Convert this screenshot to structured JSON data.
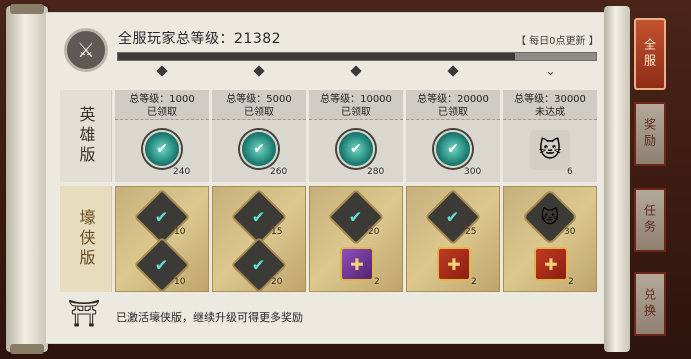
{
  "header": {
    "title_prefix": "全服玩家总等级：",
    "server_level": "21382",
    "refresh_note": "【 每日0点更新 】",
    "progress_fraction": 0.83
  },
  "rows": {
    "hero_label": "英雄版",
    "luxe_label": "壕侠版"
  },
  "tiers": [
    {
      "level_text": "总等级：1000",
      "status": "已领取",
      "hero_reward": {
        "icon": "jade-token-icon",
        "qty": "240"
      },
      "luxe_rewards": [
        {
          "icon": "ticket-icon",
          "qty": "10"
        },
        {
          "icon": "ticket-icon",
          "qty": "10"
        }
      ]
    },
    {
      "level_text": "总等级：5000",
      "status": "已领取",
      "hero_reward": {
        "icon": "jade-token-icon",
        "qty": "260"
      },
      "luxe_rewards": [
        {
          "icon": "ticket-icon",
          "qty": "15"
        },
        {
          "icon": "ticket-icon",
          "qty": "20"
        }
      ]
    },
    {
      "level_text": "总等级：10000",
      "status": "已领取",
      "hero_reward": {
        "icon": "jade-token-icon",
        "qty": "280"
      },
      "luxe_rewards": [
        {
          "icon": "ticket-icon",
          "qty": "20"
        },
        {
          "icon": "purple-gift-icon",
          "qty": "2"
        }
      ]
    },
    {
      "level_text": "总等级：20000",
      "status": "已领取",
      "hero_reward": {
        "icon": "jade-token-icon",
        "qty": "300"
      },
      "luxe_rewards": [
        {
          "icon": "ticket-icon",
          "qty": "25"
        },
        {
          "icon": "red-gift-icon",
          "qty": "2"
        }
      ]
    },
    {
      "level_text": "总等级：30000",
      "status": "未达成",
      "hero_reward": {
        "icon": "cat-pet-icon",
        "qty": "6"
      },
      "luxe_rewards": [
        {
          "icon": "cat-crate-icon",
          "qty": "30"
        },
        {
          "icon": "red-gift-icon",
          "qty": "2"
        }
      ]
    }
  ],
  "footer": {
    "message": "已激活壕侠版，继续升级可得更多奖励"
  },
  "side_tabs": [
    {
      "label": "全服",
      "active": true
    },
    {
      "label": "奖励",
      "active": false
    },
    {
      "label": "任务",
      "active": false
    },
    {
      "label": "兑换",
      "active": false
    }
  ],
  "colors": {
    "paper": "#ece9e1",
    "luxe_gold": "#dcc88f",
    "active_tab": "#b04326",
    "token_teal": "#3fb3a3"
  }
}
